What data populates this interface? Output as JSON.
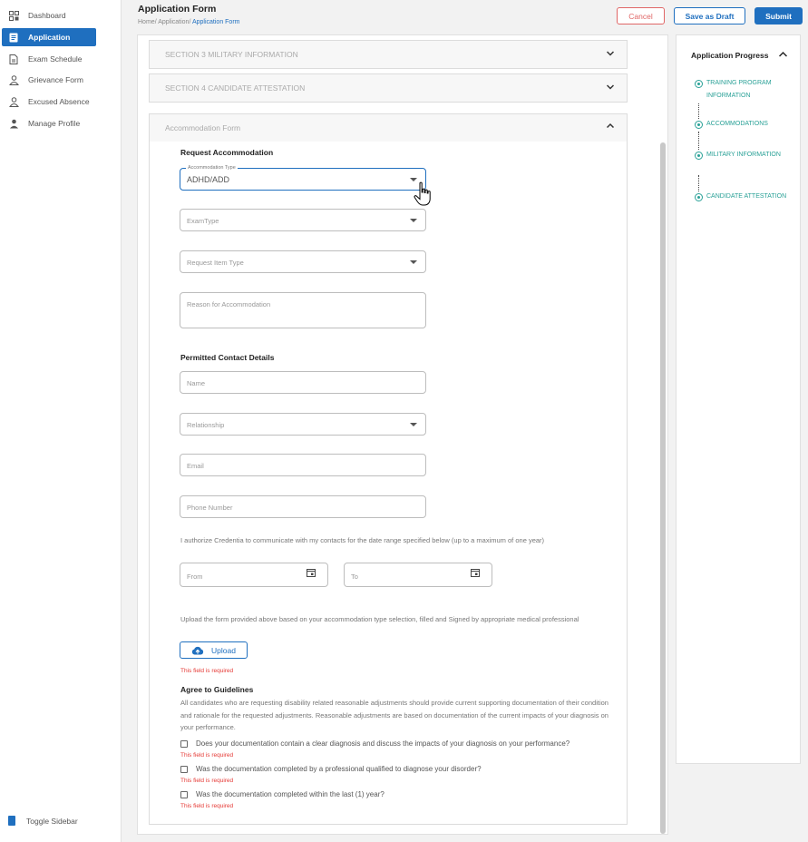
{
  "sidebar": {
    "items": [
      {
        "label": "Dashboard",
        "icon": "dashboard-icon",
        "active": false
      },
      {
        "label": "Application",
        "icon": "document-icon",
        "active": true
      },
      {
        "label": "Exam Schedule",
        "icon": "calendar-file-icon",
        "active": false
      },
      {
        "label": "Grievance Form",
        "icon": "user-form-icon",
        "active": false
      },
      {
        "label": "Excused Absence",
        "icon": "user-absence-icon",
        "active": false
      },
      {
        "label": "Manage Profile",
        "icon": "user-icon",
        "active": false
      }
    ],
    "toggle_label": "Toggle Sidebar"
  },
  "header": {
    "title": "Application Form",
    "breadcrumb": [
      "Home",
      "Application",
      "Application Form"
    ],
    "cancel_label": "Cancel",
    "draft_label": "Save as Draft",
    "submit_label": "Submit"
  },
  "sections": {
    "military": "SECTION 3  MILITARY INFORMATION",
    "attestation": "SECTION 4  CANDIDATE ATTESTATION",
    "accommodation": "Accommodation Form"
  },
  "form": {
    "request_title": "Request Accommodation",
    "accommodation_type_label": "Accommodation Type",
    "accommodation_type_value": "ADHD/ADD",
    "exam_type_placeholder": "ExamType",
    "request_item_placeholder": "Request Item Type",
    "reason_placeholder": "Reason for Accommodation",
    "contact_title": "Permitted Contact Details",
    "name_placeholder": "Name",
    "relationship_placeholder": "Relationship",
    "email_placeholder": "Email",
    "phone_placeholder": "Phone Number",
    "authorize_text": "I authorize Credentia to communicate with my contacts for the date range specified below (up to a maximum of one year)",
    "from_placeholder": "From",
    "to_placeholder": "To",
    "upload_text": "Upload the form provided above based on your accommodation type selection, filled and Signed by appropriate medical professional",
    "upload_label": "Upload",
    "required_text": "This field is required",
    "guidelines_title": "Agree to Guidelines",
    "guidelines_text": "All candidates who are requesting disability related reasonable adjustments should provide current supporting documentation of their condition and rationale for the requested adjustments. Reasonable adjustments are based on documentation of the current impacts of your diagnosis on your performance.",
    "checks": [
      "Does your documentation contain a clear diagnosis and discuss the impacts of your diagnosis on your performance?",
      "Was the documentation completed by a professional qualified to diagnose your disorder?",
      "Was the documentation completed within the last (1) year?"
    ]
  },
  "progress": {
    "title": "Application Progress",
    "steps": [
      "TRAINING PROGRAM INFORMATION",
      "ACCOMMODATIONS",
      "MILITARY INFORMATION",
      "CANDIDATE ATTESTATION"
    ]
  },
  "colors": {
    "primary": "#1f6fbf",
    "danger": "#e53935",
    "teal": "#2aa197"
  }
}
